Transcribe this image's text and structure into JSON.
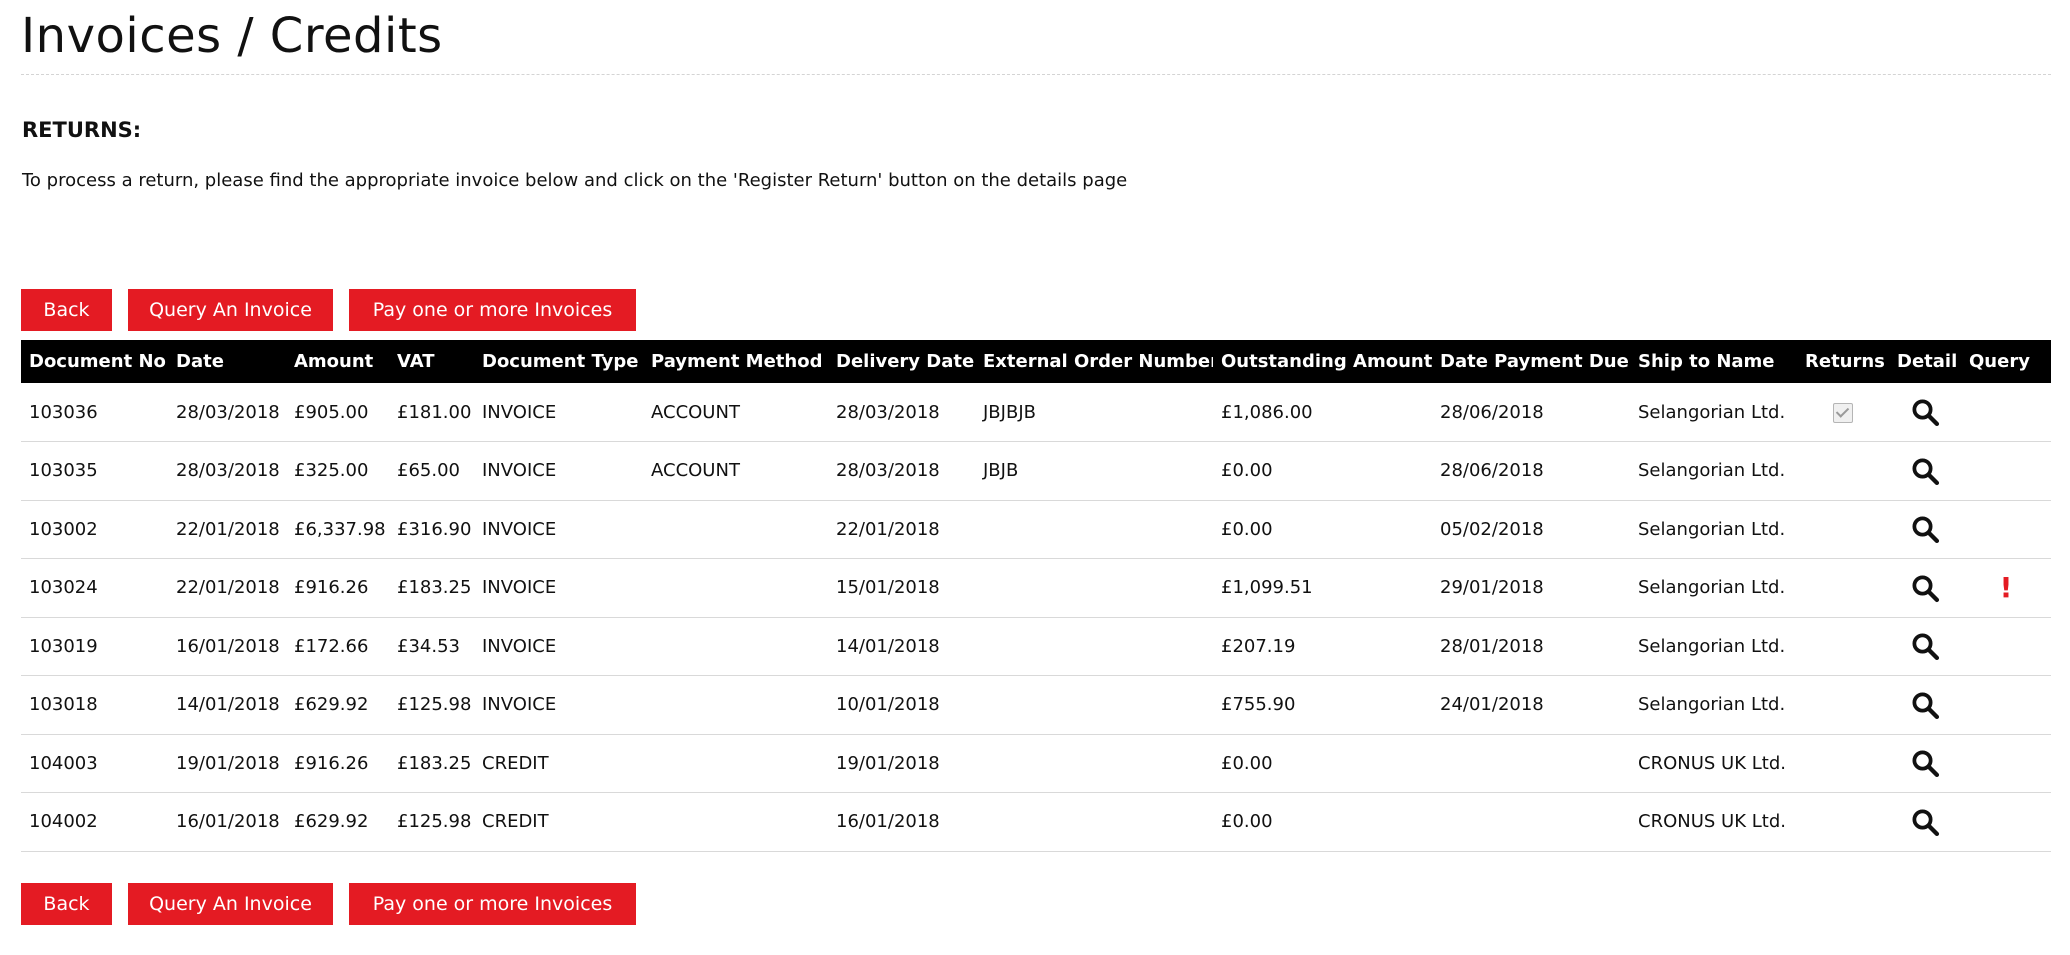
{
  "page": {
    "title": "Invoices / Credits",
    "subheading": "RETURNS:",
    "intro": "To process a return, please find the appropriate invoice below and click on the 'Register Return' button on the details page"
  },
  "buttons": {
    "back": "Back",
    "query": "Query An Invoice",
    "pay": "Pay one or more Invoices"
  },
  "colors": {
    "accent": "#e41b23",
    "header_bg": "#000000"
  },
  "table": {
    "columns": [
      "Document No",
      "Date",
      "Amount",
      "VAT",
      "Document Type",
      "Payment Method",
      "Delivery Date",
      "External Order Number",
      "Outstanding Amount",
      "Date Payment Due",
      "Ship to Name",
      "Returns",
      "Detail",
      "Query"
    ],
    "rows": [
      {
        "doc": "103036",
        "date": "28/03/2018",
        "amount": "£905.00",
        "vat": "£181.00",
        "type": "INVOICE",
        "method": "ACCOUNT",
        "delivery": "28/03/2018",
        "ext": "JBJBJB",
        "outstanding": "£1,086.00",
        "due": "28/06/2018",
        "ship": "Selangorian Ltd.",
        "returns_checked": true,
        "query_flag": false
      },
      {
        "doc": "103035",
        "date": "28/03/2018",
        "amount": "£325.00",
        "vat": "£65.00",
        "type": "INVOICE",
        "method": "ACCOUNT",
        "delivery": "28/03/2018",
        "ext": "JBJB",
        "outstanding": "£0.00",
        "due": "28/06/2018",
        "ship": "Selangorian Ltd.",
        "returns_checked": false,
        "query_flag": false
      },
      {
        "doc": "103002",
        "date": "22/01/2018",
        "amount": "£6,337.98",
        "vat": "£316.90",
        "type": "INVOICE",
        "method": "",
        "delivery": "22/01/2018",
        "ext": "",
        "outstanding": "£0.00",
        "due": "05/02/2018",
        "ship": "Selangorian Ltd.",
        "returns_checked": false,
        "query_flag": false
      },
      {
        "doc": "103024",
        "date": "22/01/2018",
        "amount": "£916.26",
        "vat": "£183.25",
        "type": "INVOICE",
        "method": "",
        "delivery": "15/01/2018",
        "ext": "",
        "outstanding": "£1,099.51",
        "due": "29/01/2018",
        "ship": "Selangorian Ltd.",
        "returns_checked": false,
        "query_flag": true
      },
      {
        "doc": "103019",
        "date": "16/01/2018",
        "amount": "£172.66",
        "vat": "£34.53",
        "type": "INVOICE",
        "method": "",
        "delivery": "14/01/2018",
        "ext": "",
        "outstanding": "£207.19",
        "due": "28/01/2018",
        "ship": "Selangorian Ltd.",
        "returns_checked": false,
        "query_flag": false
      },
      {
        "doc": "103018",
        "date": "14/01/2018",
        "amount": "£629.92",
        "vat": "£125.98",
        "type": "INVOICE",
        "method": "",
        "delivery": "10/01/2018",
        "ext": "",
        "outstanding": "£755.90",
        "due": "24/01/2018",
        "ship": "Selangorian Ltd.",
        "returns_checked": false,
        "query_flag": false
      },
      {
        "doc": "104003",
        "date": "19/01/2018",
        "amount": "£916.26",
        "vat": "£183.25",
        "type": "CREDIT",
        "method": "",
        "delivery": "19/01/2018",
        "ext": "",
        "outstanding": "£0.00",
        "due": "",
        "ship": "CRONUS UK Ltd.",
        "returns_checked": false,
        "query_flag": false
      },
      {
        "doc": "104002",
        "date": "16/01/2018",
        "amount": "£629.92",
        "vat": "£125.98",
        "type": "CREDIT",
        "method": "",
        "delivery": "16/01/2018",
        "ext": "",
        "outstanding": "£0.00",
        "due": "",
        "ship": "CRONUS UK Ltd.",
        "returns_checked": false,
        "query_flag": false
      }
    ],
    "query_flag_symbol": "!",
    "detail_icon": "search-icon",
    "returns_icon": "checkbox-icon",
    "query_icon": "alert-icon"
  }
}
